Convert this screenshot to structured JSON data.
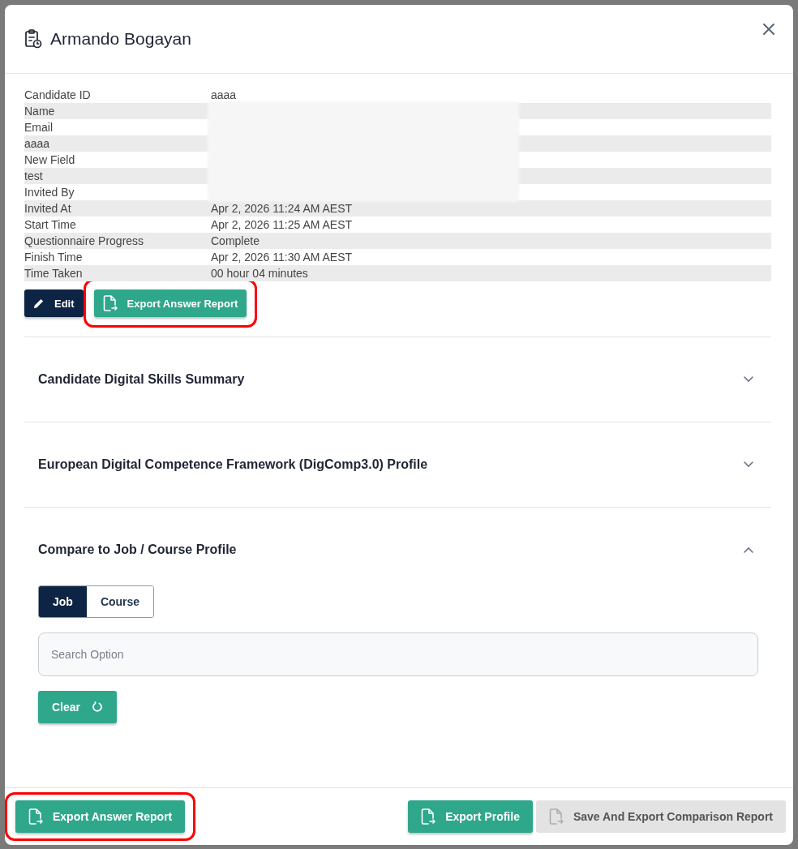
{
  "dialog": {
    "title": "Armando Bogayan"
  },
  "details": [
    {
      "label": "Candidate ID",
      "value": "aaaa",
      "redacted": false
    },
    {
      "label": "Name",
      "redacted": true
    },
    {
      "label": "Email",
      "redacted": true
    },
    {
      "label": "aaaa",
      "redacted": true
    },
    {
      "label": "New Field",
      "redacted": true
    },
    {
      "label": "test",
      "redacted": true
    },
    {
      "label": "Invited By",
      "redacted": true
    },
    {
      "label": "Invited At",
      "value": "Apr 2, 2026 11:24 AM AEST",
      "redacted": false
    },
    {
      "label": "Start Time",
      "value": "Apr 2, 2026 11:25 AM AEST",
      "redacted": false
    },
    {
      "label": "Questionnaire Progress",
      "value": "Complete",
      "redacted": false
    },
    {
      "label": "Finish Time",
      "value": "Apr 2, 2026 11:30 AM AEST",
      "redacted": false
    },
    {
      "label": "Time Taken",
      "value": "00 hour 04 minutes",
      "redacted": false
    }
  ],
  "detail_actions": [
    {
      "kind": "edit",
      "label": "Edit",
      "highlighted": false
    },
    {
      "kind": "export",
      "label": "Export Answer Report",
      "highlighted": true
    }
  ],
  "sections": [
    {
      "title": "Candidate Digital Skills Summary",
      "expanded": false
    },
    {
      "title": "European Digital Competence Framework (DigComp3.0) Profile",
      "expanded": false
    },
    {
      "title": "Compare to Job / Course Profile",
      "expanded": true,
      "toggle": [
        {
          "label": "Job",
          "selected": true
        },
        {
          "label": "Course",
          "selected": false
        }
      ],
      "search": {
        "placeholder": "Search Option"
      },
      "clear_button": "Clear"
    }
  ],
  "footer": [
    {
      "label": "Export Answer Report",
      "disabled": false,
      "highlighted": true
    },
    {
      "label": "Export Profile",
      "disabled": false,
      "highlighted": false
    },
    {
      "label": "Save And Export Comparison Report",
      "disabled": true,
      "highlighted": false
    }
  ]
}
